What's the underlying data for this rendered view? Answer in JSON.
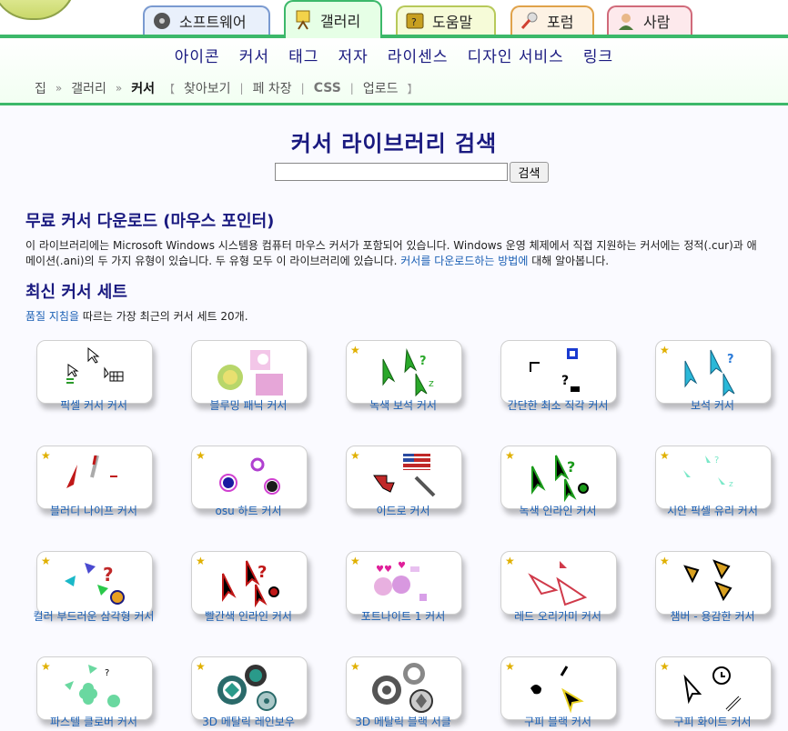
{
  "tabs": [
    {
      "label": "소프트웨어",
      "icon": "disc-icon"
    },
    {
      "label": "갤러리",
      "icon": "easel-icon"
    },
    {
      "label": "도움말",
      "icon": "help-book-icon"
    },
    {
      "label": "포럼",
      "icon": "microphone-icon"
    },
    {
      "label": "사람",
      "icon": "person-icon"
    }
  ],
  "nav": [
    "아이콘",
    "커서",
    "태그",
    "저자",
    "라이센스",
    "디자인 서비스",
    "링크"
  ],
  "breadcrumb": {
    "home": "집",
    "gallery": "갤러리",
    "current": "커서",
    "sub": [
      "찾아보기",
      "페 차장",
      "CSS",
      "업로드"
    ]
  },
  "page": {
    "title": "커서 라이브러리 검색",
    "search_placeholder": "",
    "search_button": "검색"
  },
  "intro": {
    "heading": "무료 커서 다운로드 (마우스 포인터)",
    "line1": "이 라이브러리에는 Microsoft Windows 시스템용 컴퓨터 마우스 커서가 포함되어 있습니다. Windows 운영 체제에서 직접 지원하는 커서에는 정적(.cur)과 애",
    "line2a": "메이션(.ani)의 두 가지 유형이 있습니다. 두 유형 모두 이 라이브러리에 있습니다. ",
    "line2link": "커서를 다운로드하는 방법에",
    "line2b": " 대해 알아봅니다."
  },
  "latest": {
    "heading": "최신 커서 세트",
    "link": "품질 지침을",
    "text": " 따르는 가장 최근의 커서 세트 20개."
  },
  "cards": [
    {
      "label": "픽셀 커서 커서",
      "star": false,
      "art": "pixel"
    },
    {
      "label": "블루밍 패닉 커서",
      "star": false,
      "art": "blooming"
    },
    {
      "label": "녹색 보석 커서",
      "star": true,
      "art": "greengem"
    },
    {
      "label": "간단한 최소 직각 커서",
      "star": false,
      "art": "minimal"
    },
    {
      "label": "보석 커서",
      "star": true,
      "art": "gem"
    },
    {
      "label": "블러디 나이프 커서",
      "star": true,
      "art": "knife"
    },
    {
      "label": "osu 하트 커서",
      "star": true,
      "art": "osu"
    },
    {
      "label": "이드로 커서",
      "star": true,
      "art": "texas"
    },
    {
      "label": "녹색 인라인 커서",
      "star": true,
      "art": "greeninline"
    },
    {
      "label": "시안 픽셀 유리 커서",
      "star": true,
      "art": "cyan"
    },
    {
      "label": "컬러 부드러운 삼각형 커서",
      "star": true,
      "art": "colortri"
    },
    {
      "label": "빨간색 인라인 커서",
      "star": true,
      "art": "redinline"
    },
    {
      "label": "포트나이트 1 커서",
      "star": true,
      "art": "fortnite"
    },
    {
      "label": "레드 오리가미 커서",
      "star": true,
      "art": "origami"
    },
    {
      "label": "챔버 - 용감한 커서",
      "star": true,
      "art": "chamber"
    },
    {
      "label": "파스텔 클로버 커서",
      "star": true,
      "art": "clover"
    },
    {
      "label": "3D 메탈릭 레인보우",
      "star": true,
      "art": "rainbow"
    },
    {
      "label": "3D 메탈릭 블랙 서클",
      "star": true,
      "art": "blackcircle"
    },
    {
      "label": "구피 블랙 커서",
      "star": true,
      "art": "goofyblack"
    },
    {
      "label": "구피 화이트 커서",
      "star": true,
      "art": "goofywhite"
    }
  ],
  "colors": {
    "accent": "#3cb86a",
    "nav": "#1a1a80",
    "link": "#1a5fb4"
  }
}
